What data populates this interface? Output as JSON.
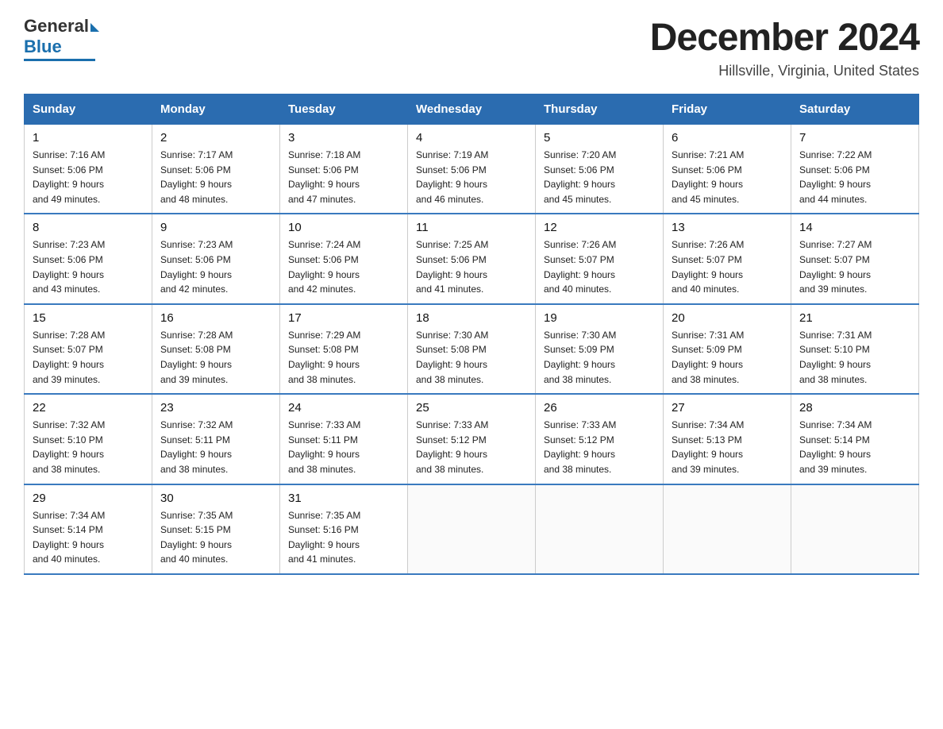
{
  "header": {
    "logo": {
      "general": "General",
      "blue": "Blue",
      "arrow": "▶"
    },
    "title": "December 2024",
    "location": "Hillsville, Virginia, United States"
  },
  "days_of_week": [
    "Sunday",
    "Monday",
    "Tuesday",
    "Wednesday",
    "Thursday",
    "Friday",
    "Saturday"
  ],
  "weeks": [
    [
      {
        "day": "1",
        "sunrise": "7:16 AM",
        "sunset": "5:06 PM",
        "daylight": "9 hours and 49 minutes."
      },
      {
        "day": "2",
        "sunrise": "7:17 AM",
        "sunset": "5:06 PM",
        "daylight": "9 hours and 48 minutes."
      },
      {
        "day": "3",
        "sunrise": "7:18 AM",
        "sunset": "5:06 PM",
        "daylight": "9 hours and 47 minutes."
      },
      {
        "day": "4",
        "sunrise": "7:19 AM",
        "sunset": "5:06 PM",
        "daylight": "9 hours and 46 minutes."
      },
      {
        "day": "5",
        "sunrise": "7:20 AM",
        "sunset": "5:06 PM",
        "daylight": "9 hours and 45 minutes."
      },
      {
        "day": "6",
        "sunrise": "7:21 AM",
        "sunset": "5:06 PM",
        "daylight": "9 hours and 45 minutes."
      },
      {
        "day": "7",
        "sunrise": "7:22 AM",
        "sunset": "5:06 PM",
        "daylight": "9 hours and 44 minutes."
      }
    ],
    [
      {
        "day": "8",
        "sunrise": "7:23 AM",
        "sunset": "5:06 PM",
        "daylight": "9 hours and 43 minutes."
      },
      {
        "day": "9",
        "sunrise": "7:23 AM",
        "sunset": "5:06 PM",
        "daylight": "9 hours and 42 minutes."
      },
      {
        "day": "10",
        "sunrise": "7:24 AM",
        "sunset": "5:06 PM",
        "daylight": "9 hours and 42 minutes."
      },
      {
        "day": "11",
        "sunrise": "7:25 AM",
        "sunset": "5:06 PM",
        "daylight": "9 hours and 41 minutes."
      },
      {
        "day": "12",
        "sunrise": "7:26 AM",
        "sunset": "5:07 PM",
        "daylight": "9 hours and 40 minutes."
      },
      {
        "day": "13",
        "sunrise": "7:26 AM",
        "sunset": "5:07 PM",
        "daylight": "9 hours and 40 minutes."
      },
      {
        "day": "14",
        "sunrise": "7:27 AM",
        "sunset": "5:07 PM",
        "daylight": "9 hours and 39 minutes."
      }
    ],
    [
      {
        "day": "15",
        "sunrise": "7:28 AM",
        "sunset": "5:07 PM",
        "daylight": "9 hours and 39 minutes."
      },
      {
        "day": "16",
        "sunrise": "7:28 AM",
        "sunset": "5:08 PM",
        "daylight": "9 hours and 39 minutes."
      },
      {
        "day": "17",
        "sunrise": "7:29 AM",
        "sunset": "5:08 PM",
        "daylight": "9 hours and 38 minutes."
      },
      {
        "day": "18",
        "sunrise": "7:30 AM",
        "sunset": "5:08 PM",
        "daylight": "9 hours and 38 minutes."
      },
      {
        "day": "19",
        "sunrise": "7:30 AM",
        "sunset": "5:09 PM",
        "daylight": "9 hours and 38 minutes."
      },
      {
        "day": "20",
        "sunrise": "7:31 AM",
        "sunset": "5:09 PM",
        "daylight": "9 hours and 38 minutes."
      },
      {
        "day": "21",
        "sunrise": "7:31 AM",
        "sunset": "5:10 PM",
        "daylight": "9 hours and 38 minutes."
      }
    ],
    [
      {
        "day": "22",
        "sunrise": "7:32 AM",
        "sunset": "5:10 PM",
        "daylight": "9 hours and 38 minutes."
      },
      {
        "day": "23",
        "sunrise": "7:32 AM",
        "sunset": "5:11 PM",
        "daylight": "9 hours and 38 minutes."
      },
      {
        "day": "24",
        "sunrise": "7:33 AM",
        "sunset": "5:11 PM",
        "daylight": "9 hours and 38 minutes."
      },
      {
        "day": "25",
        "sunrise": "7:33 AM",
        "sunset": "5:12 PM",
        "daylight": "9 hours and 38 minutes."
      },
      {
        "day": "26",
        "sunrise": "7:33 AM",
        "sunset": "5:12 PM",
        "daylight": "9 hours and 38 minutes."
      },
      {
        "day": "27",
        "sunrise": "7:34 AM",
        "sunset": "5:13 PM",
        "daylight": "9 hours and 39 minutes."
      },
      {
        "day": "28",
        "sunrise": "7:34 AM",
        "sunset": "5:14 PM",
        "daylight": "9 hours and 39 minutes."
      }
    ],
    [
      {
        "day": "29",
        "sunrise": "7:34 AM",
        "sunset": "5:14 PM",
        "daylight": "9 hours and 40 minutes."
      },
      {
        "day": "30",
        "sunrise": "7:35 AM",
        "sunset": "5:15 PM",
        "daylight": "9 hours and 40 minutes."
      },
      {
        "day": "31",
        "sunrise": "7:35 AM",
        "sunset": "5:16 PM",
        "daylight": "9 hours and 41 minutes."
      },
      null,
      null,
      null,
      null
    ]
  ]
}
